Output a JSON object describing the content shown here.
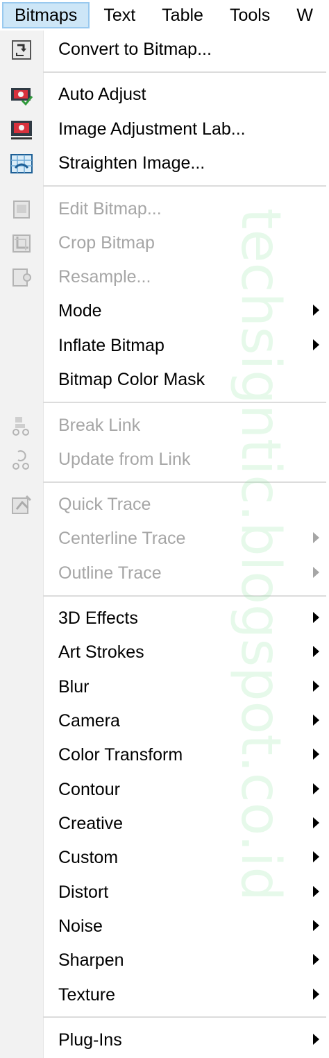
{
  "menubar": {
    "items": [
      {
        "label": "Bitmaps",
        "active": true
      },
      {
        "label": "Text"
      },
      {
        "label": "Table"
      },
      {
        "label": "Tools"
      },
      {
        "label": "W"
      }
    ]
  },
  "menu": {
    "items": [
      {
        "label": "Convert to Bitmap...",
        "icon": "convert-to-bitmap-icon",
        "enabled": true
      },
      {
        "label": "Auto Adjust",
        "icon": "auto-adjust-icon",
        "enabled": true
      },
      {
        "label": "Image Adjustment Lab...",
        "icon": "image-adjustment-lab-icon",
        "enabled": true
      },
      {
        "label": "Straighten Image...",
        "icon": "straighten-image-icon",
        "enabled": true
      },
      {
        "label": "Edit Bitmap...",
        "icon": "edit-bitmap-icon",
        "enabled": false
      },
      {
        "label": "Crop Bitmap",
        "icon": "crop-bitmap-icon",
        "enabled": false
      },
      {
        "label": "Resample...",
        "icon": "resample-icon",
        "enabled": false
      },
      {
        "label": "Mode",
        "enabled": true,
        "submenu": true
      },
      {
        "label": "Inflate Bitmap",
        "enabled": true,
        "submenu": true
      },
      {
        "label": "Bitmap Color Mask",
        "enabled": true
      },
      {
        "label": "Break Link",
        "icon": "break-link-icon",
        "enabled": false
      },
      {
        "label": "Update from Link",
        "icon": "update-from-link-icon",
        "enabled": false
      },
      {
        "label": "Quick Trace",
        "icon": "quick-trace-icon",
        "enabled": false
      },
      {
        "label": "Centerline Trace",
        "enabled": false,
        "submenu": true
      },
      {
        "label": "Outline Trace",
        "enabled": false,
        "submenu": true
      },
      {
        "label": "3D Effects",
        "enabled": true,
        "submenu": true
      },
      {
        "label": "Art Strokes",
        "enabled": true,
        "submenu": true
      },
      {
        "label": "Blur",
        "enabled": true,
        "submenu": true
      },
      {
        "label": "Camera",
        "enabled": true,
        "submenu": true
      },
      {
        "label": "Color Transform",
        "enabled": true,
        "submenu": true
      },
      {
        "label": "Contour",
        "enabled": true,
        "submenu": true
      },
      {
        "label": "Creative",
        "enabled": true,
        "submenu": true
      },
      {
        "label": "Custom",
        "enabled": true,
        "submenu": true
      },
      {
        "label": "Distort",
        "enabled": true,
        "submenu": true
      },
      {
        "label": "Noise",
        "enabled": true,
        "submenu": true
      },
      {
        "label": "Sharpen",
        "enabled": true,
        "submenu": true
      },
      {
        "label": "Texture",
        "enabled": true,
        "submenu": true
      },
      {
        "label": "Plug-Ins",
        "enabled": true,
        "submenu": true
      }
    ]
  },
  "watermark": "techsigntic.blogspot.co.id",
  "colors": {
    "disabled_text": "#a6a6a6",
    "active_menu_bg": "#cde6f7",
    "active_menu_border": "#99c9ef",
    "watermark": "#82e196"
  }
}
